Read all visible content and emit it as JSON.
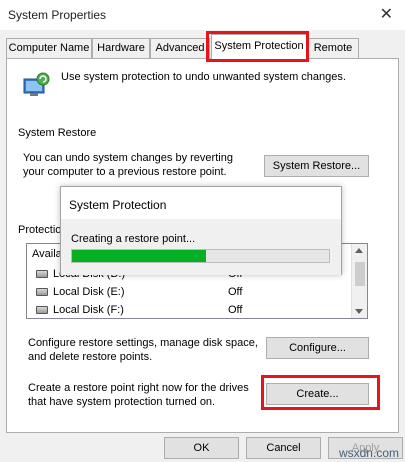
{
  "window": {
    "title": "System Properties",
    "close_glyph": "✕"
  },
  "tabs": [
    {
      "label": "Computer Name"
    },
    {
      "label": "Hardware"
    },
    {
      "label": "Advanced"
    },
    {
      "label": "System Protection"
    },
    {
      "label": "Remote"
    }
  ],
  "intro": {
    "text": "Use system protection to undo unwanted system changes."
  },
  "system_restore": {
    "heading": "System Restore",
    "description": "You can undo system changes by reverting your computer to a previous restore point.",
    "button_label": "System Restore..."
  },
  "protection": {
    "heading": "Protectio",
    "list_header": "Availa",
    "drives": [
      {
        "name": "Local Disk (D:)",
        "status": "Off"
      },
      {
        "name": "Local Disk (E:)",
        "status": "Off"
      },
      {
        "name": "Local Disk (F:)",
        "status": "Off"
      }
    ],
    "configure_text": "Configure restore settings, manage disk space, and delete restore points.",
    "configure_button": "Configure...",
    "create_text": "Create a restore point right now for the drives that have system protection turned on.",
    "create_button": "Create..."
  },
  "dialog": {
    "title": "System Protection",
    "message": "Creating a restore point...",
    "progress_fraction": 0.52,
    "progress_color": "#06b025"
  },
  "footer": {
    "ok": "OK",
    "cancel": "Cancel",
    "apply": "Apply"
  },
  "watermark": "wsxdn.com",
  "colors": {
    "highlight": "#e8141b",
    "window_bg": "#f0f0f0"
  }
}
